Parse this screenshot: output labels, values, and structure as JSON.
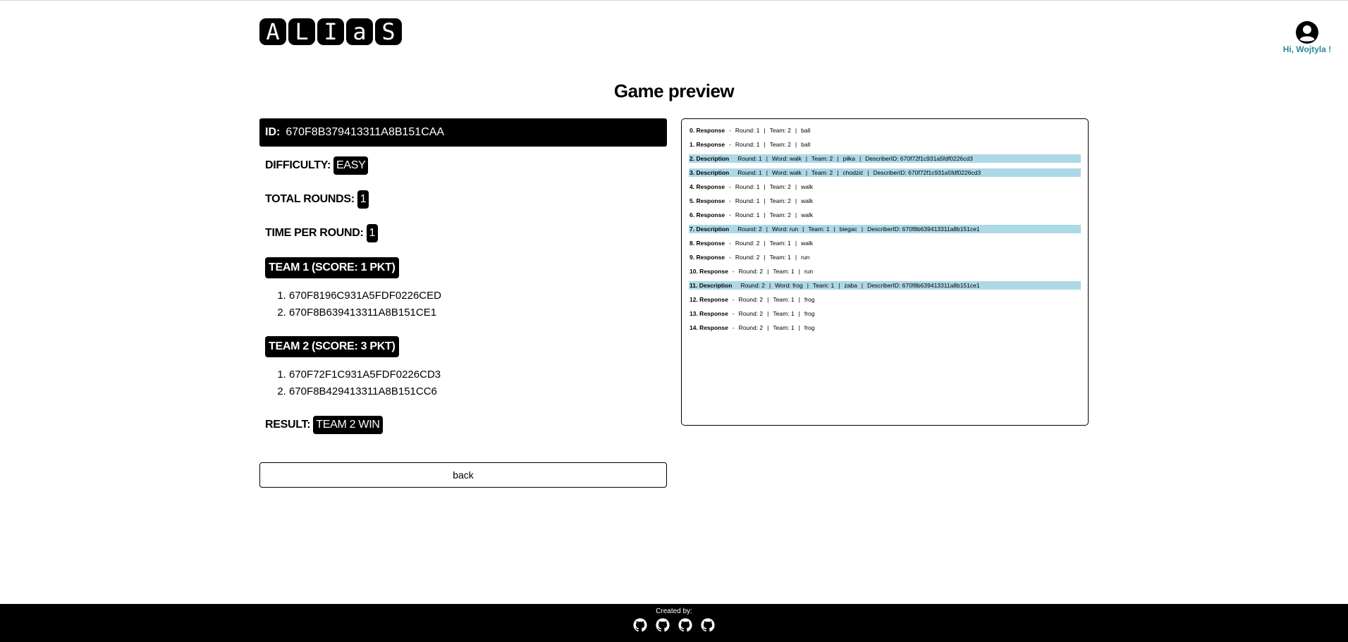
{
  "header": {
    "logo_letters": [
      "A",
      "L",
      "I",
      "a",
      "S"
    ],
    "user_greeting": "Hi, Wojtyla !"
  },
  "page_title": "Game preview",
  "game": {
    "id_label": "ID:",
    "id_value": "670F8B379413311A8B151CAA",
    "difficulty_label": "DIFFICULTY:",
    "difficulty_value": "EASY",
    "total_rounds_label": "TOTAL ROUNDS:",
    "total_rounds_value": "1",
    "time_per_round_label": "TIME PER ROUND:",
    "time_per_round_value": "1",
    "teams": [
      {
        "title": "TEAM 1 (SCORE: 1 PKT)",
        "members": [
          "670F8196C931A5FDF0226CED",
          "670F8B639413311A8B151CE1"
        ]
      },
      {
        "title": "TEAM 2 (SCORE: 3 PKT)",
        "members": [
          "670F72F1C931A5FDF0226CD3",
          "670F8B429413311A8B151CC6"
        ]
      }
    ],
    "result_label": "RESULT:",
    "result_value": "TEAM 2 WIN",
    "back_label": "back"
  },
  "log": [
    {
      "kind": "0. Response",
      "fields": [
        "Round: 1",
        "Team: 2",
        "ball"
      ],
      "highlight": false
    },
    {
      "kind": "1. Response",
      "fields": [
        "Round: 1",
        "Team: 2",
        "ball"
      ],
      "highlight": false
    },
    {
      "kind": "2. Description",
      "fields": [
        "Round: 1",
        "Word: walk",
        "Team: 2",
        "piłka",
        "DescriberID: 670f72f1c931a5fdf0226cd3"
      ],
      "highlight": true
    },
    {
      "kind": "3. Description",
      "fields": [
        "Round: 1",
        "Word: walk",
        "Team: 2",
        "chodzić",
        "DescriberID: 670f72f1c931a5fdf0226cd3"
      ],
      "highlight": true
    },
    {
      "kind": "4. Response",
      "fields": [
        "Round: 1",
        "Team: 2",
        "walk"
      ],
      "highlight": false
    },
    {
      "kind": "5. Response",
      "fields": [
        "Round: 1",
        "Team: 2",
        "walk"
      ],
      "highlight": false
    },
    {
      "kind": "6. Response",
      "fields": [
        "Round: 1",
        "Team: 2",
        "walk"
      ],
      "highlight": false
    },
    {
      "kind": "7. Description",
      "fields": [
        "Round: 2",
        "Word: run",
        "Team: 1",
        "biegac",
        "DescriberID: 670f8b639413311a8b151ce1"
      ],
      "highlight": true
    },
    {
      "kind": "8. Response",
      "fields": [
        "Round: 2",
        "Team: 1",
        "walk"
      ],
      "highlight": false
    },
    {
      "kind": "9. Response",
      "fields": [
        "Round: 2",
        "Team: 1",
        "run"
      ],
      "highlight": false
    },
    {
      "kind": "10. Response",
      "fields": [
        "Round: 2",
        "Team: 1",
        "run"
      ],
      "highlight": false
    },
    {
      "kind": "11. Description",
      "fields": [
        "Round: 2",
        "Word: frog",
        "Team: 1",
        "zaba",
        "DescriberID: 670f8b639413311a8b151ce1"
      ],
      "highlight": true
    },
    {
      "kind": "12. Response",
      "fields": [
        "Round: 2",
        "Team: 1",
        "frog"
      ],
      "highlight": false
    },
    {
      "kind": "13. Response",
      "fields": [
        "Round: 2",
        "Team: 1",
        "frog"
      ],
      "highlight": false
    },
    {
      "kind": "14. Response",
      "fields": [
        "Round: 2",
        "Team: 1",
        "frog"
      ],
      "highlight": false
    }
  ],
  "footer": {
    "label": "Created by:",
    "links": [
      "github-icon",
      "github-icon",
      "github-icon",
      "github-icon"
    ]
  },
  "colors": {
    "highlight_row": "#add8e6",
    "greeting": "#2b8a99",
    "dark": "#000000"
  }
}
